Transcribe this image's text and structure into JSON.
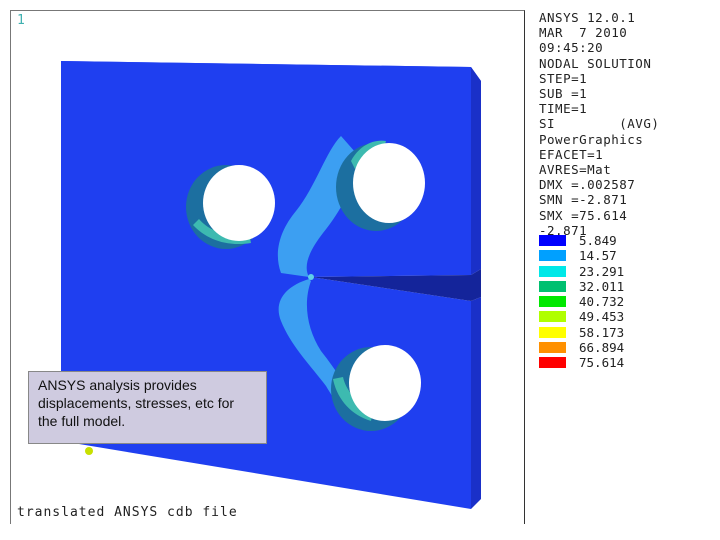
{
  "viewport": {
    "window_number": "1",
    "footer_title": "translated ANSYS cdb file"
  },
  "info_panel": {
    "lines": [
      "ANSYS 12.0.1",
      "MAR  7 2010",
      "09:45:20",
      "NODAL SOLUTION",
      "STEP=1",
      "SUB =1",
      "TIME=1",
      "SI        (AVG)",
      "PowerGraphics",
      "EFACET=1",
      "AVRES=Mat",
      "DMX =.002587",
      "SMN =-2.871",
      "SMX =75.614",
      "-2.871"
    ]
  },
  "legend": {
    "items": [
      {
        "label": "5.849",
        "color": "#0000ff"
      },
      {
        "label": "14.57",
        "color": "#00a0ff"
      },
      {
        "label": "23.291",
        "color": "#00e8e8"
      },
      {
        "label": "32.011",
        "color": "#00c070"
      },
      {
        "label": "40.732",
        "color": "#00e800"
      },
      {
        "label": "49.453",
        "color": "#b0ff00"
      },
      {
        "label": "58.173",
        "color": "#ffff00"
      },
      {
        "label": "66.894",
        "color": "#ff9000"
      },
      {
        "label": "75.614",
        "color": "#ff0000"
      }
    ]
  },
  "colors": {
    "model_face": "#1f3ff0",
    "model_side": "#1a30c8",
    "model_top": "#3a55ff",
    "stress_band": "#3c9ff2",
    "hole_wall": "#1c6fa0",
    "hole_highlight": "#3dbab0"
  },
  "callout": {
    "text": "ANSYS analysis provides displacements, stresses, etc for the full model."
  }
}
